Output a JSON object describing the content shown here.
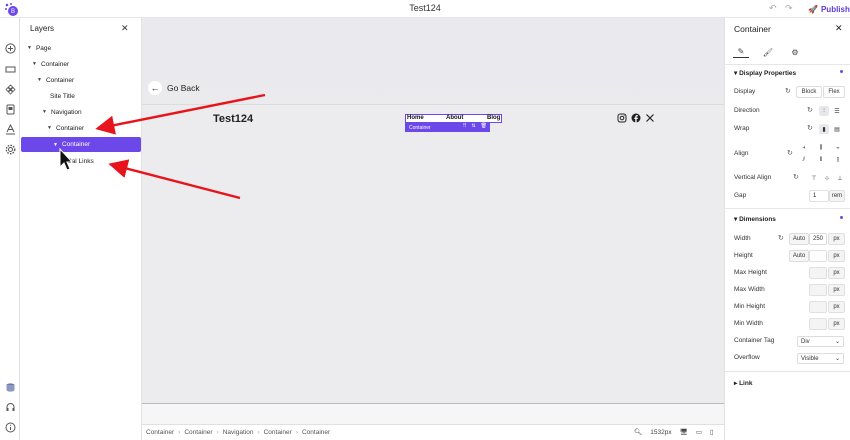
{
  "topbar": {
    "title": "Test124",
    "publish_label": "Publish",
    "undo_icon": "undo-icon",
    "redo_icon": "redo-icon"
  },
  "layers": {
    "title": "Layers",
    "tree": [
      {
        "label": "Page"
      },
      {
        "label": "Container"
      },
      {
        "label": "Container"
      },
      {
        "label": "Site Title"
      },
      {
        "label": "Navigation"
      },
      {
        "label": "Container"
      },
      {
        "label": "Container",
        "selected": true
      },
      {
        "label": "Cal Links"
      }
    ]
  },
  "canvas": {
    "go_back": "Go Back",
    "site_title": "Test124",
    "nav": {
      "links": [
        "Home",
        "About",
        "Blog"
      ],
      "tag": "Container"
    }
  },
  "breadcrumb": [
    "Container",
    "Container",
    "Navigation",
    "Container",
    "Container"
  ],
  "viewport": {
    "width_label": "1532px"
  },
  "properties": {
    "title": "Container",
    "display_section": "Display Properties",
    "display": {
      "label": "Display",
      "options": [
        "Block",
        "Flex"
      ]
    },
    "direction_label": "Direction",
    "wrap_label": "Wrap",
    "align_label": "Align",
    "vertical_align_label": "Vertical Align",
    "gap": {
      "label": "Gap",
      "value": "1",
      "unit": "rem"
    },
    "dimensions_section": "Dimensions",
    "width": {
      "label": "Width",
      "auto": "Auto",
      "value": "250",
      "unit": "px"
    },
    "height": {
      "label": "Height",
      "auto": "Auto",
      "unit": "px"
    },
    "max_height": {
      "label": "Max Height",
      "unit": "px"
    },
    "max_width": {
      "label": "Max Width",
      "unit": "px"
    },
    "min_height": {
      "label": "Min Height",
      "unit": "px"
    },
    "min_width": {
      "label": "Min Width",
      "unit": "px"
    },
    "container_tag": {
      "label": "Container Tag",
      "value": "Div"
    },
    "overflow": {
      "label": "Overflow",
      "value": "Visible"
    },
    "link_section": "Link"
  },
  "colors": {
    "accent": "#6c47ea",
    "annotation_arrow": "#e8141b"
  }
}
